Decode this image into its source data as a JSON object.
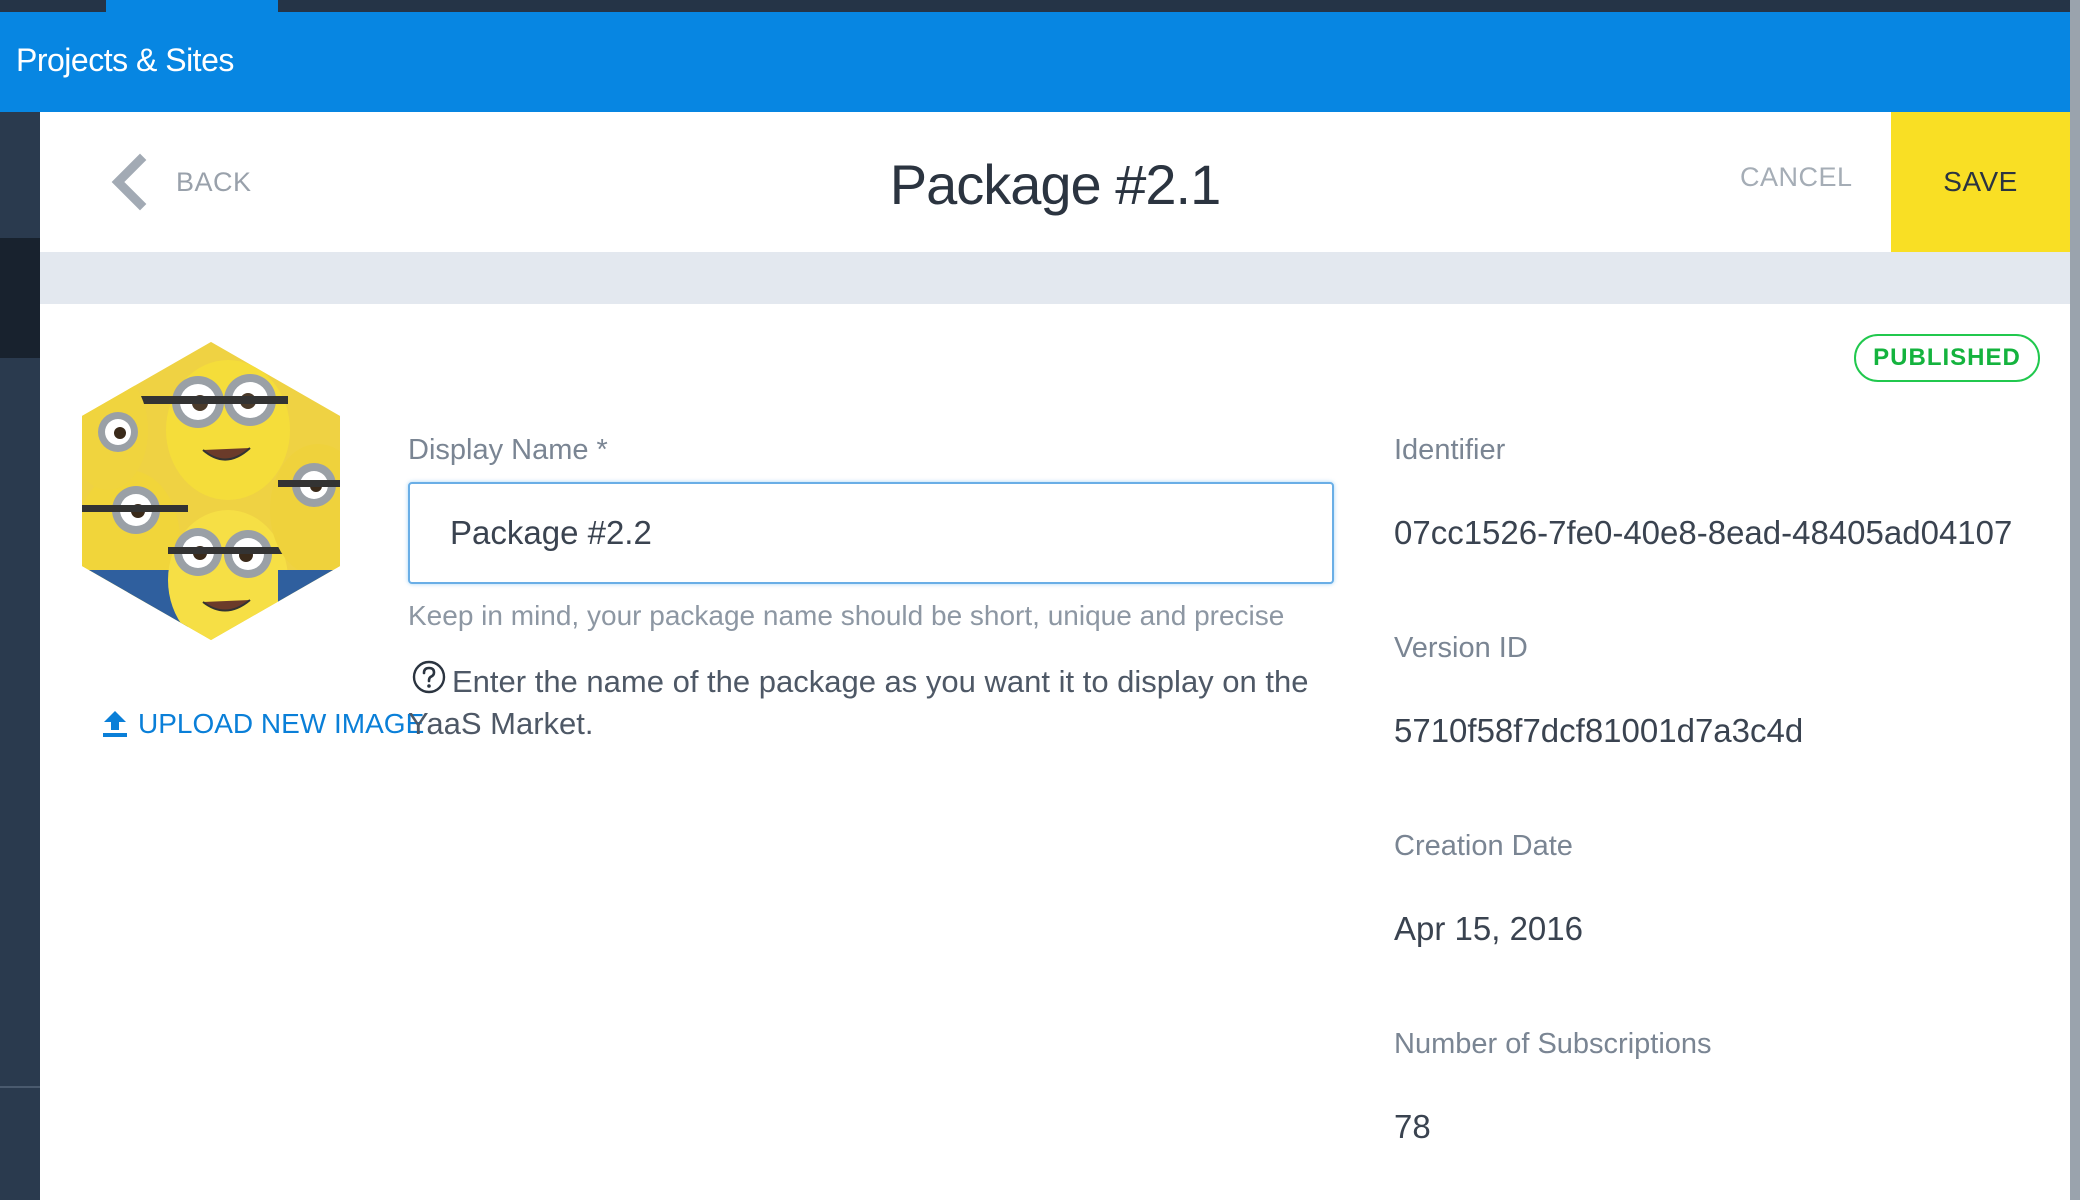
{
  "app_bar": {
    "title": "Projects & Sites"
  },
  "header": {
    "back_label": "BACK",
    "title": "Package #2.1",
    "cancel_label": "CANCEL",
    "save_label": "SAVE"
  },
  "image_panel": {
    "upload_label": "UPLOAD NEW IMAGE",
    "upload_icon": "upload-icon"
  },
  "form": {
    "display_name_label": "Display Name *",
    "display_name_value": "Package #2.2",
    "hint": "Keep in mind, your package name should be short, unique and precise",
    "help_text": "Enter the name of the package as you want it to display on the YaaS Market."
  },
  "status": {
    "label": "PUBLISHED",
    "color": "#21c84e"
  },
  "details": {
    "identifier_label": "Identifier",
    "identifier_value": "07cc1526-7fe0-40e8-8ead-48405ad04107",
    "version_label": "Version ID",
    "version_value": "5710f58f7dcf81001d7a3c4d",
    "creation_label": "Creation Date",
    "creation_value": "Apr 15, 2016",
    "subscriptions_label": "Number of Subscriptions",
    "subscriptions_value": "78"
  },
  "colors": {
    "brand_blue": "#0786e2",
    "save_yellow": "#f9df24",
    "link_blue": "#0a7fd8"
  }
}
